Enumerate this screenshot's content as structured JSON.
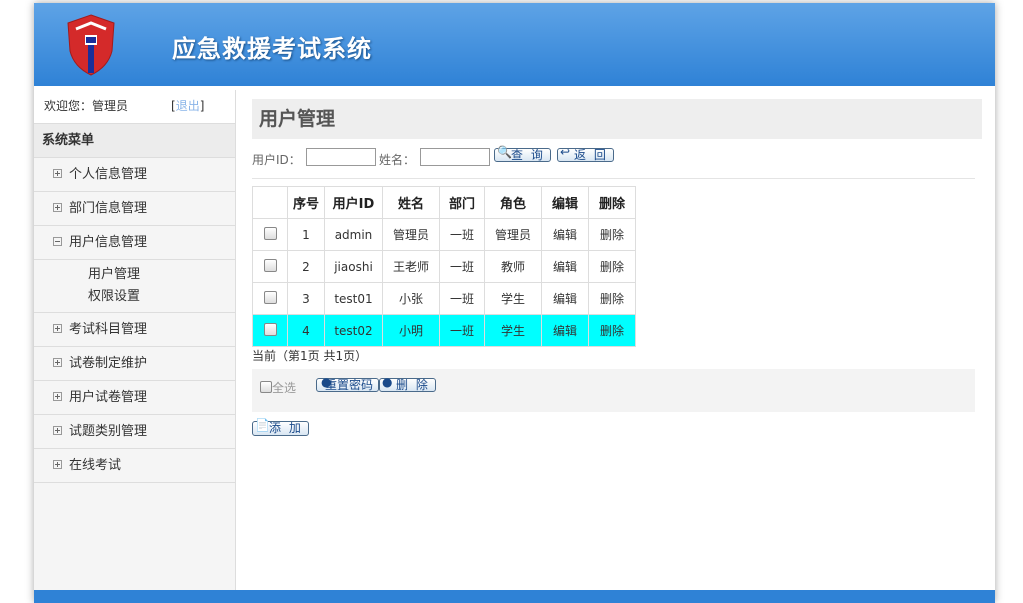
{
  "header": {
    "title": "应急救援考试系统"
  },
  "sidebar": {
    "welcome": "欢迎您：管理员",
    "logout_open": "[",
    "logout": "退出",
    "logout_close": "]",
    "menu_title": "系统菜单",
    "items": [
      {
        "label": "个人信息管理"
      },
      {
        "label": "部门信息管理"
      },
      {
        "label": "用户信息管理"
      },
      {
        "label": "考试科目管理"
      },
      {
        "label": "试卷制定维护"
      },
      {
        "label": "用户试卷管理"
      },
      {
        "label": "试题类别管理"
      },
      {
        "label": "在线考试"
      }
    ],
    "submenu": [
      {
        "label": "用户管理"
      },
      {
        "label": "权限设置"
      }
    ]
  },
  "main": {
    "title": "用户管理",
    "search": {
      "userid_label": "用户ID：",
      "userid_value": "",
      "name_label": "姓名：",
      "name_value": "",
      "query_button": "查 询",
      "back_button": "返 回"
    },
    "table": {
      "headers": [
        "",
        "序号",
        "用户ID",
        "姓名",
        "部门",
        "角色",
        "编辑",
        "删除"
      ],
      "rows": [
        {
          "no": "1",
          "userid": "admin",
          "name": "管理员",
          "dept": "一班",
          "role": "管理员",
          "edit": "编辑",
          "del": "删除"
        },
        {
          "no": "2",
          "userid": "jiaoshi",
          "name": "王老师",
          "dept": "一班",
          "role": "教师",
          "edit": "编辑",
          "del": "删除"
        },
        {
          "no": "3",
          "userid": "test01",
          "name": "小张",
          "dept": "一班",
          "role": "学生",
          "edit": "编辑",
          "del": "删除"
        },
        {
          "no": "4",
          "userid": "test02",
          "name": "小明",
          "dept": "一班",
          "role": "学生",
          "edit": "编辑",
          "del": "删除"
        }
      ],
      "highlight_color": "#00ffff"
    },
    "pager": "当前（第1页 共1页）",
    "select_all": "全选",
    "reset_password_button": "重置密码",
    "delete_button": "删 除",
    "add_button": "添 加"
  },
  "colors": {
    "header": "#2f82d6",
    "link": "#8ab4e8"
  }
}
